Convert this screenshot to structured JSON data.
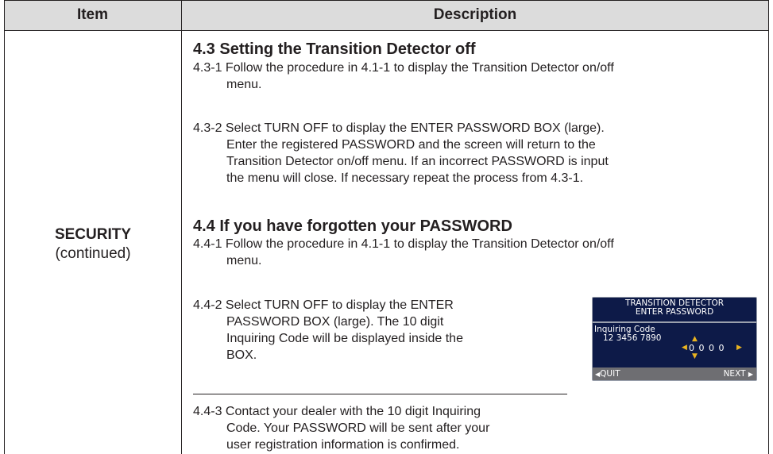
{
  "header": {
    "item_label": "Item",
    "description_label": "Description"
  },
  "item": {
    "name": "SECURITY",
    "note": "(continued)"
  },
  "sections": [
    {
      "title": "4.3 Setting the Transition Detector off",
      "steps": [
        {
          "first_line": "4.3-1 Follow the procedure in 4.1-1 to display the Transition Detector on/off",
          "continuation": [
            "menu."
          ]
        },
        {
          "first_line": "4.3-2 Select TURN OFF to display the ENTER PASSWORD BOX (large).",
          "continuation": [
            "Enter the registered PASSWORD and the screen will return to the",
            "Transition Detector on/off menu. If an incorrect PASSWORD is input",
            "the menu will close. If necessary repeat the process from 4.3-1."
          ]
        }
      ]
    },
    {
      "title": "4.4 If you have forgotten your PASSWORD",
      "steps": [
        {
          "first_line": "4.4-1 Follow the procedure in 4.1-1 to display the Transition Detector on/off",
          "continuation": [
            "menu."
          ]
        },
        {
          "first_line": "4.4-2 Select TURN OFF to display the ENTER",
          "continuation": [
            "PASSWORD BOX (large). The 10 digit",
            "Inquiring Code will be displayed inside the",
            "BOX."
          ]
        },
        {
          "first_line": "4.4-3 Contact your dealer with the 10 digit Inquiring",
          "continuation": [
            "Code. Your PASSWORD will be sent after your",
            "user registration information is confirmed."
          ]
        }
      ]
    }
  ],
  "screen": {
    "title_line1": "TRANSITION DETECTOR",
    "title_line2": "ENTER PASSWORD",
    "code_label": "Inquiring Code",
    "code_value": "12 3456 7890",
    "digits": "0 0 0 0",
    "quit_label": "QUIT",
    "next_label": "NEXT",
    "colors": {
      "background": "#0d1a48",
      "footer": "#6e6e72",
      "arrow": "#e9b320"
    }
  }
}
